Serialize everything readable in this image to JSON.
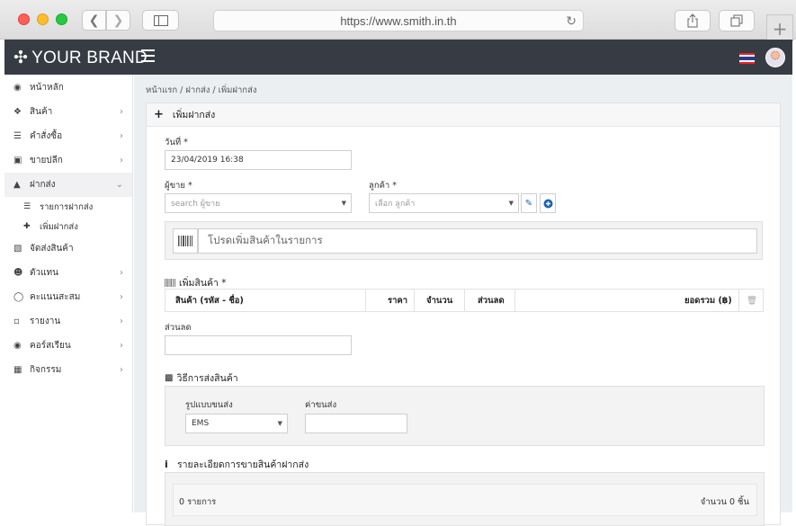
{
  "browser": {
    "url": "https://www.smith.in.th"
  },
  "app": {
    "brand": "YOUR BRAND"
  },
  "sidebar": {
    "items": [
      {
        "label": "หน้าหลัก",
        "icon": "dashboard-icon"
      },
      {
        "label": "สินค้า",
        "icon": "cubes-icon"
      },
      {
        "label": "คำสั่งซื้อ",
        "icon": "list-icon"
      },
      {
        "label": "ขายปลีก",
        "icon": "basket-icon"
      },
      {
        "label": "ฝากส่ง",
        "icon": "cart-icon"
      },
      {
        "label": "จัดส่งสินค้า",
        "icon": "truck-icon"
      },
      {
        "label": "ตัวแทน",
        "icon": "users-icon"
      },
      {
        "label": "คะแนนสะสม",
        "icon": "trophy-icon"
      },
      {
        "label": "รายงาน",
        "icon": "bar-chart-icon"
      },
      {
        "label": "คอร์สเรียน",
        "icon": "play-circle-icon"
      },
      {
        "label": "กิจกรรม",
        "icon": "calendar-icon"
      }
    ],
    "sub_items": [
      {
        "label": "รายการฝากส่ง"
      },
      {
        "label": "เพิ่มฝากส่ง"
      }
    ]
  },
  "breadcrumb": "หน้าแรก / ฝากส่ง / เพิ่มฝากส่ง",
  "form": {
    "title": "เพิ่มฝากส่ง",
    "date_label": "วันที่ *",
    "date_value": "23/04/2019 16:38",
    "seller_label": "ผู้ขาย *",
    "seller_placeholder": "search ผู้ขาย",
    "customer_label": "ลูกค้า *",
    "customer_placeholder": "เลือก ลูกค้า",
    "barcode_placeholder": "โปรดเพิ่มสินค้าในรายการ",
    "add_product_label": "เพิ่มสินค้า *",
    "table_headers": {
      "product": "สินค้า (รหัส - ชื่อ)",
      "price": "ราคา",
      "quantity": "จำนวน",
      "discount": "ส่วนลด",
      "total": "ยอดรวม (฿)"
    },
    "discount_label": "ส่วนลด",
    "shipping_title": "วิธีการส่งสินค้า",
    "shipping_type_label": "รูปแบบขนส่ง",
    "shipping_type_value": "EMS",
    "shipping_fee_label": "ค่าขนส่ง",
    "details_title": "รายละเอียดการขายสินค้าฝากส่ง",
    "details_count": "0 รายการ",
    "details_qty": "จำนวน 0 ชิ้น"
  }
}
